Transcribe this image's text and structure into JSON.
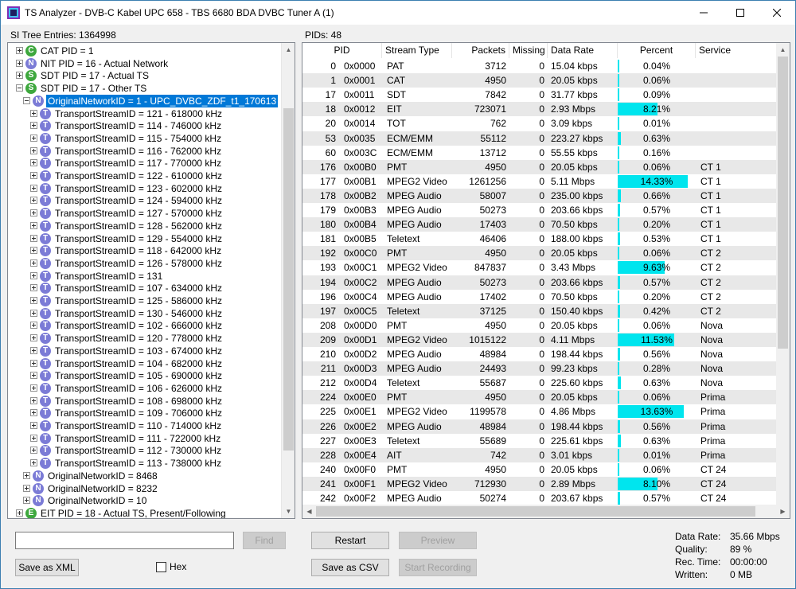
{
  "window": {
    "title": "TS Analyzer - DVB-C Kabel UPC 658 - TBS 6680 BDA DVBC Tuner A (1)"
  },
  "tree": {
    "header": "SI Tree Entries: 1364998",
    "nodes": [
      {
        "level": 0,
        "icon": "C",
        "exp": "plus",
        "label": "CAT PID = 1"
      },
      {
        "level": 0,
        "icon": "N",
        "exp": "plus",
        "label": "NIT PID = 16 - Actual Network"
      },
      {
        "level": 0,
        "icon": "S",
        "exp": "plus",
        "label": "SDT PID = 17 - Actual TS"
      },
      {
        "level": 0,
        "icon": "S",
        "exp": "minus",
        "label": "SDT PID = 17 - Other TS"
      },
      {
        "level": 1,
        "icon": "N",
        "exp": "minus",
        "label": "OriginalNetworkID = 1 - UPC_DVBC_ZDF_t1_170613",
        "selected": true
      },
      {
        "level": 2,
        "icon": "T",
        "exp": "plus",
        "label": "TransportStreamID = 121 - 618000 kHz"
      },
      {
        "level": 2,
        "icon": "T",
        "exp": "plus",
        "label": "TransportStreamID = 114 - 746000 kHz"
      },
      {
        "level": 2,
        "icon": "T",
        "exp": "plus",
        "label": "TransportStreamID = 115 - 754000 kHz"
      },
      {
        "level": 2,
        "icon": "T",
        "exp": "plus",
        "label": "TransportStreamID = 116 - 762000 kHz"
      },
      {
        "level": 2,
        "icon": "T",
        "exp": "plus",
        "label": "TransportStreamID = 117 - 770000 kHz"
      },
      {
        "level": 2,
        "icon": "T",
        "exp": "plus",
        "label": "TransportStreamID = 122 - 610000 kHz"
      },
      {
        "level": 2,
        "icon": "T",
        "exp": "plus",
        "label": "TransportStreamID = 123 - 602000 kHz"
      },
      {
        "level": 2,
        "icon": "T",
        "exp": "plus",
        "label": "TransportStreamID = 124 - 594000 kHz"
      },
      {
        "level": 2,
        "icon": "T",
        "exp": "plus",
        "label": "TransportStreamID = 127 - 570000 kHz"
      },
      {
        "level": 2,
        "icon": "T",
        "exp": "plus",
        "label": "TransportStreamID = 128 - 562000 kHz"
      },
      {
        "level": 2,
        "icon": "T",
        "exp": "plus",
        "label": "TransportStreamID = 129 - 554000 kHz"
      },
      {
        "level": 2,
        "icon": "T",
        "exp": "plus",
        "label": "TransportStreamID = 118 - 642000 kHz"
      },
      {
        "level": 2,
        "icon": "T",
        "exp": "plus",
        "label": "TransportStreamID = 126 - 578000 kHz"
      },
      {
        "level": 2,
        "icon": "T",
        "exp": "plus",
        "label": "TransportStreamID = 131"
      },
      {
        "level": 2,
        "icon": "T",
        "exp": "plus",
        "label": "TransportStreamID = 107 - 634000 kHz"
      },
      {
        "level": 2,
        "icon": "T",
        "exp": "plus",
        "label": "TransportStreamID = 125 - 586000 kHz"
      },
      {
        "level": 2,
        "icon": "T",
        "exp": "plus",
        "label": "TransportStreamID = 130 - 546000 kHz"
      },
      {
        "level": 2,
        "icon": "T",
        "exp": "plus",
        "label": "TransportStreamID = 102 - 666000 kHz"
      },
      {
        "level": 2,
        "icon": "T",
        "exp": "plus",
        "label": "TransportStreamID = 120 - 778000 kHz"
      },
      {
        "level": 2,
        "icon": "T",
        "exp": "plus",
        "label": "TransportStreamID = 103 - 674000 kHz"
      },
      {
        "level": 2,
        "icon": "T",
        "exp": "plus",
        "label": "TransportStreamID = 104 - 682000 kHz"
      },
      {
        "level": 2,
        "icon": "T",
        "exp": "plus",
        "label": "TransportStreamID = 105 - 690000 kHz"
      },
      {
        "level": 2,
        "icon": "T",
        "exp": "plus",
        "label": "TransportStreamID = 106 - 626000 kHz"
      },
      {
        "level": 2,
        "icon": "T",
        "exp": "plus",
        "label": "TransportStreamID = 108 - 698000 kHz"
      },
      {
        "level": 2,
        "icon": "T",
        "exp": "plus",
        "label": "TransportStreamID = 109 - 706000 kHz"
      },
      {
        "level": 2,
        "icon": "T",
        "exp": "plus",
        "label": "TransportStreamID = 110 - 714000 kHz"
      },
      {
        "level": 2,
        "icon": "T",
        "exp": "plus",
        "label": "TransportStreamID = 111 - 722000 kHz"
      },
      {
        "level": 2,
        "icon": "T",
        "exp": "plus",
        "label": "TransportStreamID = 112 - 730000 kHz"
      },
      {
        "level": 2,
        "icon": "T",
        "exp": "plus",
        "label": "TransportStreamID = 113 - 738000 kHz"
      },
      {
        "level": 1,
        "icon": "N",
        "exp": "plus",
        "label": "OriginalNetworkID = 8468"
      },
      {
        "level": 1,
        "icon": "N",
        "exp": "plus",
        "label": "OriginalNetworkID = 8232"
      },
      {
        "level": 1,
        "icon": "N",
        "exp": "plus",
        "label": "OriginalNetworkID = 10"
      },
      {
        "level": 0,
        "icon": "E",
        "exp": "plus",
        "label": "EIT PID = 18 - Actual TS, Present/Following"
      }
    ]
  },
  "pids": {
    "header": "PIDs: 48",
    "columns": [
      "PID",
      "Stream Type",
      "Packets",
      "Missing",
      "Data Rate",
      "Percent",
      "Service"
    ],
    "rows": [
      {
        "pid": "0",
        "hex": "0x0000",
        "type": "PAT",
        "packets": "3712",
        "missing": "0",
        "rate": "15.04 kbps",
        "percent": "0.04%",
        "pct": 0.04,
        "service": ""
      },
      {
        "pid": "1",
        "hex": "0x0001",
        "type": "CAT",
        "packets": "4950",
        "missing": "0",
        "rate": "20.05 kbps",
        "percent": "0.06%",
        "pct": 0.06,
        "service": ""
      },
      {
        "pid": "17",
        "hex": "0x0011",
        "type": "SDT",
        "packets": "7842",
        "missing": "0",
        "rate": "31.77 kbps",
        "percent": "0.09%",
        "pct": 0.09,
        "service": ""
      },
      {
        "pid": "18",
        "hex": "0x0012",
        "type": "EIT",
        "packets": "723071",
        "missing": "0",
        "rate": "2.93 Mbps",
        "percent": "8.21%",
        "pct": 8.21,
        "service": ""
      },
      {
        "pid": "20",
        "hex": "0x0014",
        "type": "TOT",
        "packets": "762",
        "missing": "0",
        "rate": "3.09 kbps",
        "percent": "0.01%",
        "pct": 0.01,
        "service": ""
      },
      {
        "pid": "53",
        "hex": "0x0035",
        "type": "ECM/EMM",
        "packets": "55112",
        "missing": "0",
        "rate": "223.27 kbps",
        "percent": "0.63%",
        "pct": 0.63,
        "service": ""
      },
      {
        "pid": "60",
        "hex": "0x003C",
        "type": "ECM/EMM",
        "packets": "13712",
        "missing": "0",
        "rate": "55.55 kbps",
        "percent": "0.16%",
        "pct": 0.16,
        "service": ""
      },
      {
        "pid": "176",
        "hex": "0x00B0",
        "type": "PMT",
        "packets": "4950",
        "missing": "0",
        "rate": "20.05 kbps",
        "percent": "0.06%",
        "pct": 0.06,
        "service": "CT 1"
      },
      {
        "pid": "177",
        "hex": "0x00B1",
        "type": "MPEG2 Video",
        "packets": "1261256",
        "missing": "0",
        "rate": "5.11 Mbps",
        "percent": "14.33%",
        "pct": 14.33,
        "service": "CT 1"
      },
      {
        "pid": "178",
        "hex": "0x00B2",
        "type": "MPEG Audio",
        "packets": "58007",
        "missing": "0",
        "rate": "235.00 kbps",
        "percent": "0.66%",
        "pct": 0.66,
        "service": "CT 1"
      },
      {
        "pid": "179",
        "hex": "0x00B3",
        "type": "MPEG Audio",
        "packets": "50273",
        "missing": "0",
        "rate": "203.66 kbps",
        "percent": "0.57%",
        "pct": 0.57,
        "service": "CT 1"
      },
      {
        "pid": "180",
        "hex": "0x00B4",
        "type": "MPEG Audio",
        "packets": "17403",
        "missing": "0",
        "rate": "70.50 kbps",
        "percent": "0.20%",
        "pct": 0.2,
        "service": "CT 1"
      },
      {
        "pid": "181",
        "hex": "0x00B5",
        "type": "Teletext",
        "packets": "46406",
        "missing": "0",
        "rate": "188.00 kbps",
        "percent": "0.53%",
        "pct": 0.53,
        "service": "CT 1"
      },
      {
        "pid": "192",
        "hex": "0x00C0",
        "type": "PMT",
        "packets": "4950",
        "missing": "0",
        "rate": "20.05 kbps",
        "percent": "0.06%",
        "pct": 0.06,
        "service": "CT 2"
      },
      {
        "pid": "193",
        "hex": "0x00C1",
        "type": "MPEG2 Video",
        "packets": "847837",
        "missing": "0",
        "rate": "3.43 Mbps",
        "percent": "9.63%",
        "pct": 9.63,
        "service": "CT 2"
      },
      {
        "pid": "194",
        "hex": "0x00C2",
        "type": "MPEG Audio",
        "packets": "50273",
        "missing": "0",
        "rate": "203.66 kbps",
        "percent": "0.57%",
        "pct": 0.57,
        "service": "CT 2"
      },
      {
        "pid": "196",
        "hex": "0x00C4",
        "type": "MPEG Audio",
        "packets": "17402",
        "missing": "0",
        "rate": "70.50 kbps",
        "percent": "0.20%",
        "pct": 0.2,
        "service": "CT 2"
      },
      {
        "pid": "197",
        "hex": "0x00C5",
        "type": "Teletext",
        "packets": "37125",
        "missing": "0",
        "rate": "150.40 kbps",
        "percent": "0.42%",
        "pct": 0.42,
        "service": "CT 2"
      },
      {
        "pid": "208",
        "hex": "0x00D0",
        "type": "PMT",
        "packets": "4950",
        "missing": "0",
        "rate": "20.05 kbps",
        "percent": "0.06%",
        "pct": 0.06,
        "service": "Nova"
      },
      {
        "pid": "209",
        "hex": "0x00D1",
        "type": "MPEG2 Video",
        "packets": "1015122",
        "missing": "0",
        "rate": "4.11 Mbps",
        "percent": "11.53%",
        "pct": 11.53,
        "service": "Nova"
      },
      {
        "pid": "210",
        "hex": "0x00D2",
        "type": "MPEG Audio",
        "packets": "48984",
        "missing": "0",
        "rate": "198.44 kbps",
        "percent": "0.56%",
        "pct": 0.56,
        "service": "Nova"
      },
      {
        "pid": "211",
        "hex": "0x00D3",
        "type": "MPEG Audio",
        "packets": "24493",
        "missing": "0",
        "rate": "99.23 kbps",
        "percent": "0.28%",
        "pct": 0.28,
        "service": "Nova"
      },
      {
        "pid": "212",
        "hex": "0x00D4",
        "type": "Teletext",
        "packets": "55687",
        "missing": "0",
        "rate": "225.60 kbps",
        "percent": "0.63%",
        "pct": 0.63,
        "service": "Nova"
      },
      {
        "pid": "224",
        "hex": "0x00E0",
        "type": "PMT",
        "packets": "4950",
        "missing": "0",
        "rate": "20.05 kbps",
        "percent": "0.06%",
        "pct": 0.06,
        "service": "Prima"
      },
      {
        "pid": "225",
        "hex": "0x00E1",
        "type": "MPEG2 Video",
        "packets": "1199578",
        "missing": "0",
        "rate": "4.86 Mbps",
        "percent": "13.63%",
        "pct": 13.63,
        "service": "Prima"
      },
      {
        "pid": "226",
        "hex": "0x00E2",
        "type": "MPEG Audio",
        "packets": "48984",
        "missing": "0",
        "rate": "198.44 kbps",
        "percent": "0.56%",
        "pct": 0.56,
        "service": "Prima"
      },
      {
        "pid": "227",
        "hex": "0x00E3",
        "type": "Teletext",
        "packets": "55689",
        "missing": "0",
        "rate": "225.61 kbps",
        "percent": "0.63%",
        "pct": 0.63,
        "service": "Prima"
      },
      {
        "pid": "228",
        "hex": "0x00E4",
        "type": "AIT",
        "packets": "742",
        "missing": "0",
        "rate": "3.01 kbps",
        "percent": "0.01%",
        "pct": 0.01,
        "service": "Prima"
      },
      {
        "pid": "240",
        "hex": "0x00F0",
        "type": "PMT",
        "packets": "4950",
        "missing": "0",
        "rate": "20.05 kbps",
        "percent": "0.06%",
        "pct": 0.06,
        "service": "CT 24"
      },
      {
        "pid": "241",
        "hex": "0x00F1",
        "type": "MPEG2 Video",
        "packets": "712930",
        "missing": "0",
        "rate": "2.89 Mbps",
        "percent": "8.10%",
        "pct": 8.1,
        "service": "CT 24"
      },
      {
        "pid": "242",
        "hex": "0x00F2",
        "type": "MPEG Audio",
        "packets": "50274",
        "missing": "0",
        "rate": "203.67 kbps",
        "percent": "0.57%",
        "pct": 0.57,
        "service": "CT 24"
      }
    ]
  },
  "controls": {
    "find_value": "",
    "find_label": "Find",
    "save_xml_label": "Save as XML",
    "hex_label": "Hex",
    "hex_checked": false,
    "restart_label": "Restart",
    "preview_label": "Preview",
    "save_csv_label": "Save as CSV",
    "start_recording_label": "Start Recording"
  },
  "stats": [
    {
      "key": "Data Rate:",
      "value": "35.66 Mbps"
    },
    {
      "key": "Quality:",
      "value": "89 %"
    },
    {
      "key": "Rec. Time:",
      "value": "00:00:00"
    },
    {
      "key": "Written:",
      "value": "0 MB"
    }
  ],
  "colors": {
    "percent_bar": "#00e5ee",
    "selection": "#0078d7",
    "row_alt": "#e8e8e8"
  }
}
